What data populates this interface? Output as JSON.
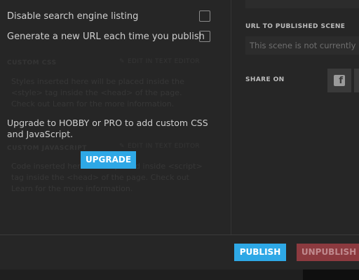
{
  "options": [
    {
      "label": "Disable search engine listing",
      "checked": false
    },
    {
      "label": "Generate a new URL each time you publish",
      "checked": false
    }
  ],
  "custom_css": {
    "label": "CUSTOM CSS",
    "edit_label": "EDIT IN TEXT EDITOR",
    "help": "Styles inserted here will be placed inside the <style> tag inside the <head> of the page. Check out Learn for the more information."
  },
  "custom_js": {
    "label": "CUSTOM JAVASCRIPT",
    "edit_label": "EDIT IN TEXT EDITOR",
    "help": "Code inserted here will be placed inside <script> tag inside the <head> of the page. Check out Learn for the more information."
  },
  "upgrade": {
    "message": "Upgrade to HOBBY or PRO to add custom CSS and JavaScript.",
    "button": "UPGRADE"
  },
  "publish_panel": {
    "url_label": "URL TO PUBLISHED SCENE",
    "url_value": "This scene is not currently published",
    "share_label": "SHARE ON"
  },
  "footer": {
    "publish": "PUBLISH",
    "unpublish": "UNPUBLISH"
  },
  "colors": {
    "accent": "#2ea8e6",
    "danger": "#8c3a3f",
    "background": "#262626"
  },
  "icons": {
    "facebook": "facebook-icon",
    "edit": "pencil-icon"
  }
}
